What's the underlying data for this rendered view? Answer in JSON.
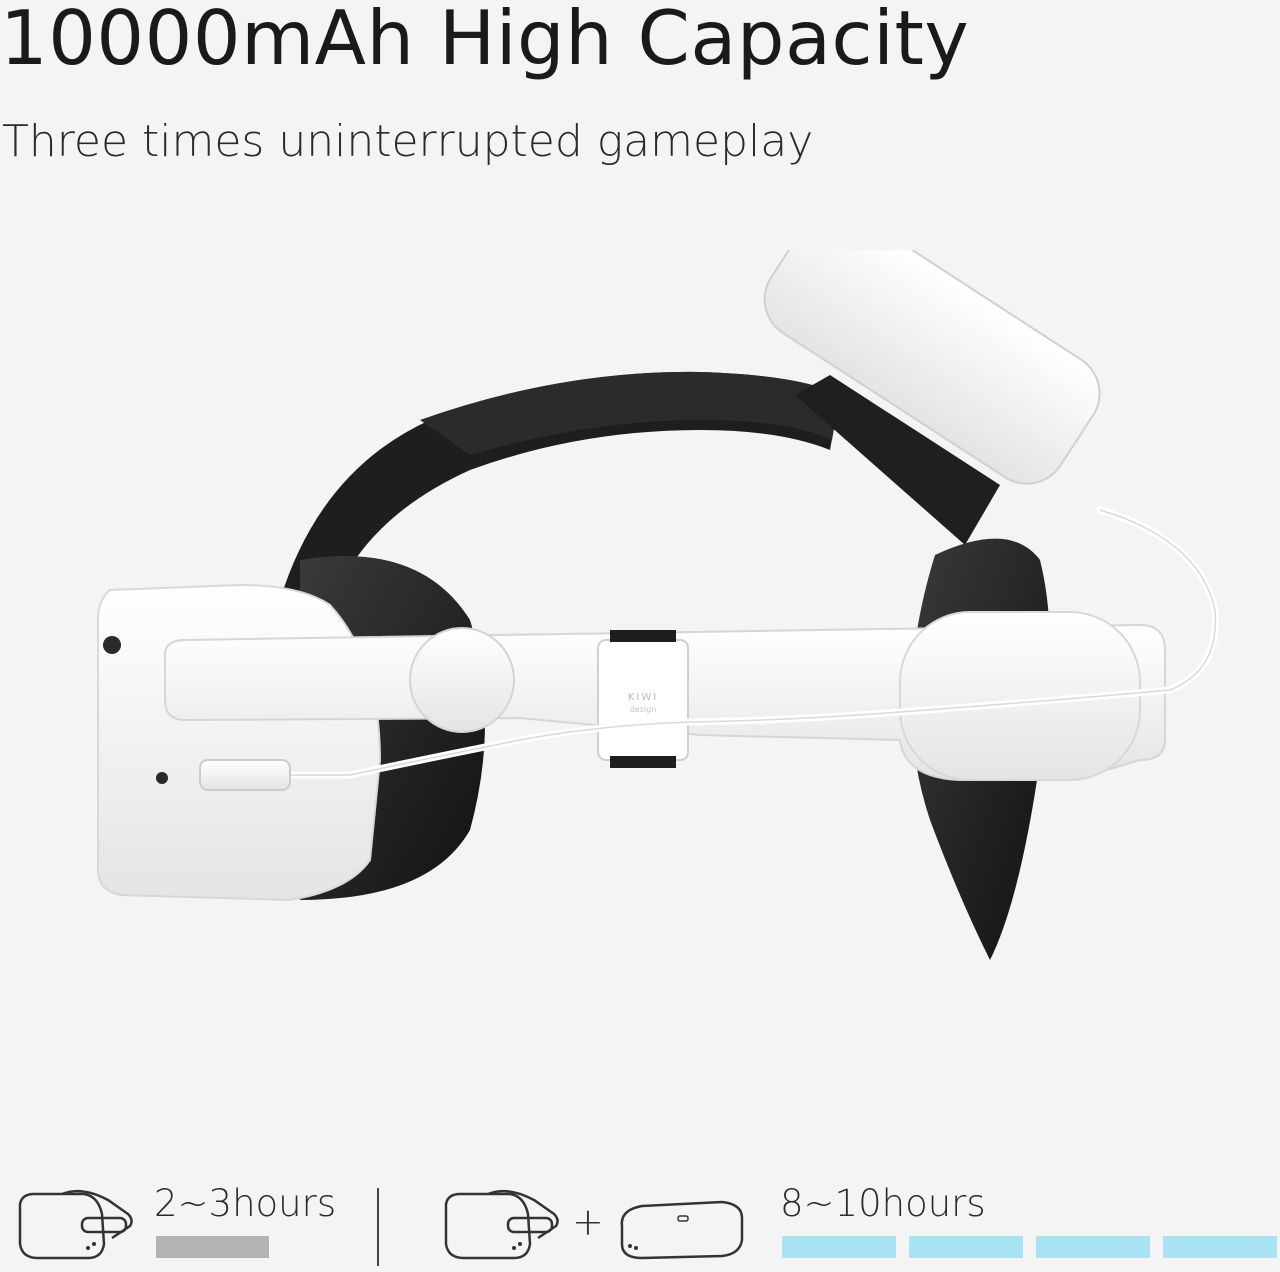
{
  "headline": "10000mAh High Capacity",
  "subheadline": "Three times uninterrupted gameplay",
  "product": {
    "description_icon": "vr-headset-with-battery-strap",
    "brand_mark": "KIWI design"
  },
  "comparison": {
    "without_battery": {
      "icon": "vr-headset-icon",
      "label": "2~3hours",
      "bar_color": "#b3b3b3",
      "bar_segments": 1
    },
    "operator": "+",
    "with_battery": {
      "icons": [
        "vr-headset-icon",
        "battery-pack-icon"
      ],
      "label": "8~10hours",
      "bar_color": "#a9e4f5",
      "bar_segments": 4
    }
  },
  "colors": {
    "background": "#f4f4f4",
    "headset_white": "#ffffff",
    "strap_black": "#1e1e1e"
  }
}
